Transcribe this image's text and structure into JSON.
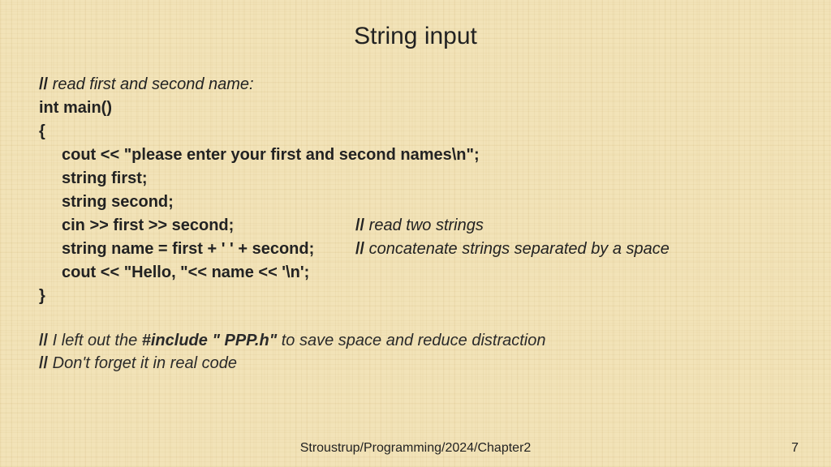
{
  "title": "String input",
  "code": {
    "c0_slash": "//",
    "c0_text": " read first and second name:",
    "l1": "int main()",
    "l2": "{",
    "l3": "cout << \"please enter your first and second names\\n\";",
    "l4": "string first;",
    "l5": "string second;",
    "l6_code": "cin >> first >> second;",
    "l6_slash": "//",
    "l6_text": " read two strings",
    "l7_code": "string name = first + ' ' + second;",
    "l7_slash": "//",
    "l7_text": " concatenate strings separated by a space",
    "l8": "cout << \"Hello, \"<< name << '\\n';",
    "l9": "}"
  },
  "notes": {
    "n1_slash": "//",
    "n1_a": " I left out the ",
    "n1_bold": "#include \" PPP.h\"",
    "n1_b": " to save space and reduce distraction",
    "n2_slash": "//",
    "n2_text": " Don't forget it in real code"
  },
  "footer": "Stroustrup/Programming/2024/Chapter2",
  "page": "7"
}
